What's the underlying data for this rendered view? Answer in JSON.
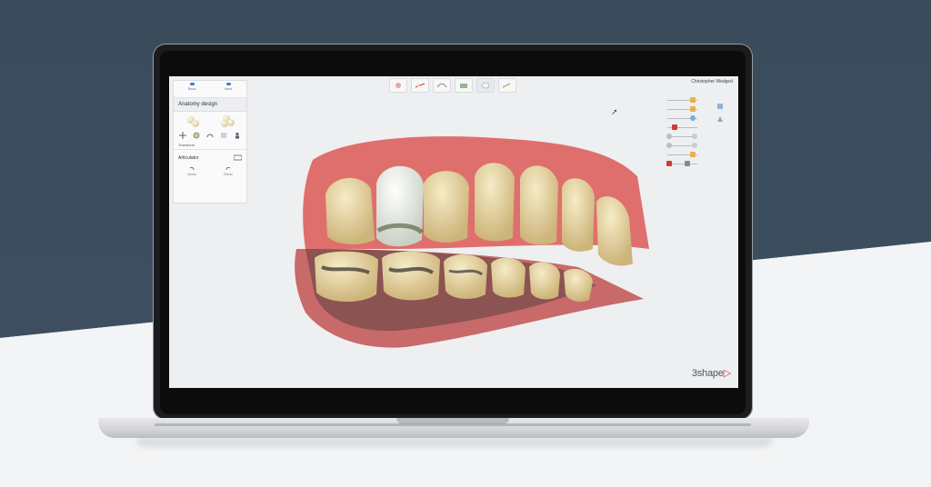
{
  "app": {
    "user_name": "Christopher Wedged",
    "brand": "3shape",
    "brand_mark": "▷"
  },
  "panel": {
    "top_buttons": [
      {
        "label": "Back",
        "icon": "arrow-left-icon"
      },
      {
        "label": "Next",
        "icon": "arrow-right-icon"
      }
    ],
    "title": "Anatomy design",
    "transform_label": "Transform",
    "articulator_label": "Articulator",
    "undo_buttons": [
      {
        "label": "Undo",
        "icon": "undo-icon"
      },
      {
        "label": "Redo",
        "icon": "redo-icon"
      }
    ]
  },
  "toolbar": {
    "tools": [
      "margin-line-icon",
      "insertion-icon",
      "bridge-icon",
      "anatomy-icon",
      "crown-icon",
      "sculpt-icon"
    ]
  },
  "colors": {
    "gum": "#e0716f",
    "tooth": "#e9d8ab",
    "crown": "#f4f5ee",
    "brand_accent": "#d23a34",
    "ui_blue": "#3b7fd1"
  },
  "sliders": [
    {
      "color": "#e8b24a"
    },
    {
      "color": "#e8b24a"
    },
    {
      "color": "#6fb1d9"
    },
    {
      "color": "#d23a34"
    },
    {
      "color": "#b9bec5"
    },
    {
      "color": "#b9bec5"
    },
    {
      "color": "#e8b24a"
    },
    {
      "color": "#d23a34"
    }
  ]
}
